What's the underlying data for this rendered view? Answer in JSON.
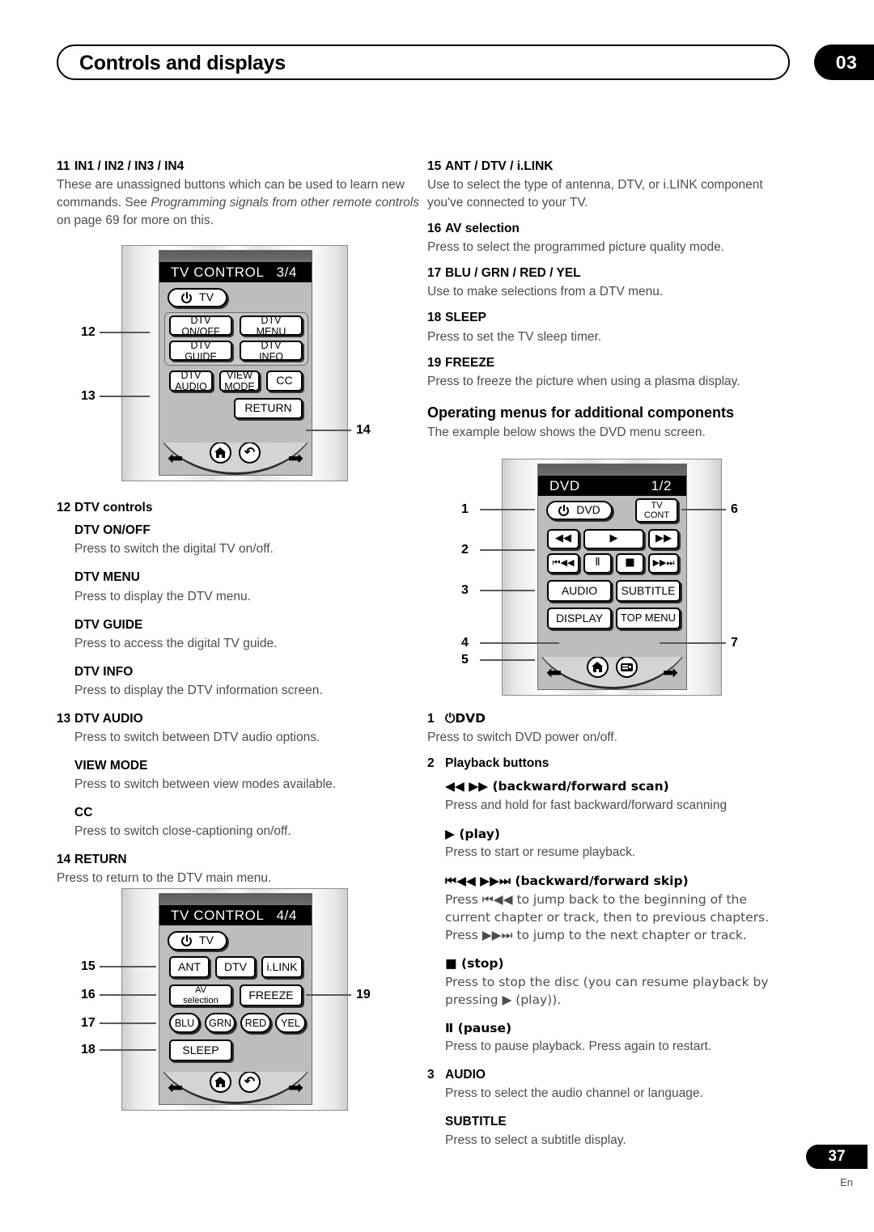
{
  "header": {
    "title": "Controls and displays",
    "chapter": "03"
  },
  "footer": {
    "page": "37",
    "lang": "En"
  },
  "left_column": {
    "entries": [
      {
        "num": "11",
        "title": "IN1 / IN2 / IN3 / IN4",
        "body_pre": "These are unassigned buttons which can be used to learn new commands. See ",
        "body_italic": "Programming signals from other remote controls",
        "body_post": " on page 69 for more on this."
      },
      {
        "num": "12",
        "title": "DTV controls",
        "body": ""
      },
      {
        "num": "",
        "title": "DTV ON/OFF",
        "body": "Press to switch the digital TV on/off."
      },
      {
        "num": "",
        "title": "DTV MENU",
        "body": "Press to display the DTV menu."
      },
      {
        "num": "",
        "title": "DTV GUIDE",
        "body": "Press to access the digital TV guide."
      },
      {
        "num": "",
        "title": "DTV INFO",
        "body": "Press to display the DTV information screen."
      },
      {
        "num": "13",
        "title": "DTV AUDIO",
        "body": "Press to switch between DTV audio options."
      },
      {
        "num": "",
        "title": "VIEW MODE",
        "body": "Press to switch between view modes available."
      },
      {
        "num": "",
        "title": "CC",
        "body": "Press to switch close-captioning on/off."
      },
      {
        "num": "14",
        "title": "RETURN",
        "body": "Press to return to the DTV main menu."
      }
    ]
  },
  "right_column": {
    "entries": [
      {
        "num": "15",
        "title": "ANT / DTV / i.LINK",
        "body": "Use to select the type of antenna, DTV, or i.LINK component you've connected to your TV."
      },
      {
        "num": "16",
        "title": "AV selection",
        "body": "Press to select the programmed picture quality mode."
      },
      {
        "num": "17",
        "title": "BLU / GRN / RED / YEL",
        "body": "Use to make selections from a DTV menu."
      },
      {
        "num": "18",
        "title": "SLEEP",
        "body": "Press to set the TV sleep timer."
      },
      {
        "num": "19",
        "title": "FREEZE",
        "body": "Press to freeze the picture when using a plasma display."
      }
    ],
    "section": {
      "heading": "Operating menus for additional components",
      "intro": "The example below shows the DVD menu screen."
    },
    "dvd_entries": [
      {
        "num": "1",
        "title": "⏻DVD",
        "body": "Press to switch DVD power on/off."
      },
      {
        "num": "2",
        "title": "Playback buttons",
        "body": ""
      },
      {
        "num": "",
        "title": "◀◀ ▶▶ (backward/forward scan)",
        "body": "Press and hold for fast backward/forward scanning"
      },
      {
        "num": "",
        "title": "▶ (play)",
        "body": "Press to start or resume playback."
      },
      {
        "num": "",
        "title": "⏮◀◀ ▶▶⏭ (backward/forward skip)",
        "body": "Press ⏮◀◀ to jump back to the beginning of the current chapter or track, then to previous chapters. Press ▶▶⏭ to jump to the next chapter or track."
      },
      {
        "num": "",
        "title": "■ (stop)",
        "body": "Press to stop the disc (you can resume playback by pressing ▶ (play))."
      },
      {
        "num": "",
        "title": "Ⅱ (pause)",
        "body": "Press to pause playback. Press again to restart."
      },
      {
        "num": "3",
        "title": "AUDIO",
        "body": "Press to select the audio channel or language."
      },
      {
        "num": "",
        "title": "SUBTITLE",
        "body": "Press to select a subtitle display."
      }
    ]
  },
  "remote_tv34": {
    "screen_title": "TV  CONTROL",
    "screen_page": "3/4",
    "power_label": "TV",
    "buttons": [
      {
        "l1": "DTV",
        "l2": "ON/OFF"
      },
      {
        "l1": "DTV",
        "l2": "MENU"
      },
      {
        "l1": "DTV",
        "l2": "GUIDE"
      },
      {
        "l1": "DTV",
        "l2": "INFO"
      },
      {
        "l1": "DTV",
        "l2": "AUDIO"
      },
      {
        "l1": "VIEW",
        "l2": "MODE"
      },
      {
        "l1": "CC",
        "l2": ""
      },
      {
        "l1": "RETURN",
        "l2": ""
      }
    ],
    "callouts": [
      "12",
      "13",
      "14"
    ],
    "nav": {
      "left": "⬅",
      "right": "➡",
      "home": "home-icon",
      "back": "back-icon"
    }
  },
  "remote_tv44": {
    "screen_title": "TV  CONTROL",
    "screen_page": "4/4",
    "power_label": "TV",
    "buttons": [
      {
        "l1": "ANT",
        "l2": ""
      },
      {
        "l1": "DTV",
        "l2": ""
      },
      {
        "l1": "i.LINK",
        "l2": ""
      },
      {
        "l1": "AV",
        "l2": "selection"
      },
      {
        "l1": "FREEZE",
        "l2": ""
      },
      {
        "l1": "BLU",
        "l2": ""
      },
      {
        "l1": "GRN",
        "l2": ""
      },
      {
        "l1": "RED",
        "l2": ""
      },
      {
        "l1": "YEL",
        "l2": ""
      },
      {
        "l1": "SLEEP",
        "l2": ""
      }
    ],
    "callouts": [
      "15",
      "16",
      "17",
      "18",
      "19"
    ]
  },
  "remote_dvd": {
    "screen_title": "DVD",
    "screen_page": "1/2",
    "power_label": "DVD",
    "tv_cont": {
      "l1": "TV",
      "l2": "CONT"
    },
    "transport": [
      "◀◀",
      "▶",
      "▶▶",
      "⏮◀◀",
      "Ⅱ",
      "■",
      "▶▶⏭"
    ],
    "buttons": [
      "AUDIO",
      "SUBTITLE",
      "DISPLAY",
      "TOP MENU"
    ],
    "callouts": [
      "1",
      "2",
      "3",
      "4",
      "5",
      "6",
      "7"
    ]
  }
}
